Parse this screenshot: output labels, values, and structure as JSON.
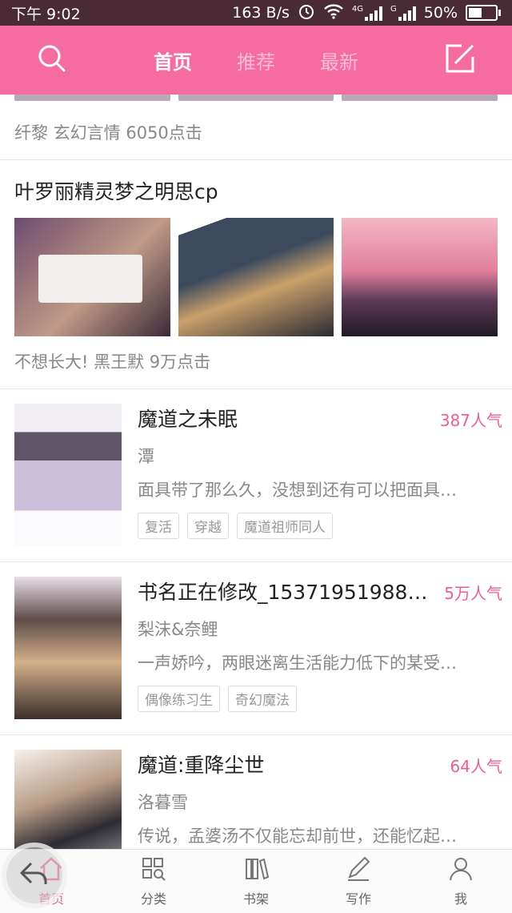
{
  "status_bar": {
    "time": "下午 9:02",
    "speed": "163 B/s",
    "net_4g": "4G",
    "net_g": "G",
    "battery": "50%",
    "battery_level": 0.5
  },
  "header": {
    "tabs": [
      {
        "label": "首页",
        "active": true
      },
      {
        "label": "推荐",
        "active": false
      },
      {
        "label": "最新",
        "active": false
      }
    ],
    "icons": {
      "left": "search-icon",
      "right": "edit-icon"
    },
    "accent": "#f56ca0"
  },
  "feed": {
    "partial_meta": "纤黎   玄幻言情   6050点击",
    "collection": {
      "title": "叶罗丽精灵梦之明思cp",
      "meta": "不想长大!  黑王默   9万点击"
    },
    "books": [
      {
        "title": "魔道之未眠",
        "popularity": "387人气",
        "author": "潭",
        "desc": "面具带了那么久，没想到还有可以把面具…",
        "tags": [
          "复活",
          "穿越",
          "魔道祖师同人"
        ]
      },
      {
        "title": "书名正在修改_1537195198826…",
        "popularity": "5万人气",
        "author": "梨沫&奈鲤",
        "desc": "一声娇吟，两眼迷离生活能力低下的某受…",
        "tags": [
          "偶像练习生",
          "奇幻魔法"
        ]
      },
      {
        "title": "魔道:重降尘世",
        "popularity": "64人气",
        "author": "洛暮雪",
        "desc": "传说，孟婆汤不仅能忘却前世，还能忆起…",
        "tags": []
      }
    ]
  },
  "bottom_nav": [
    {
      "label": "首页",
      "icon": "home-icon",
      "active": true
    },
    {
      "label": "分类",
      "icon": "category-icon",
      "active": false
    },
    {
      "label": "书架",
      "icon": "bookshelf-icon",
      "active": false
    },
    {
      "label": "写作",
      "icon": "pen-icon",
      "active": false
    },
    {
      "label": "我",
      "icon": "user-icon",
      "active": false
    }
  ]
}
